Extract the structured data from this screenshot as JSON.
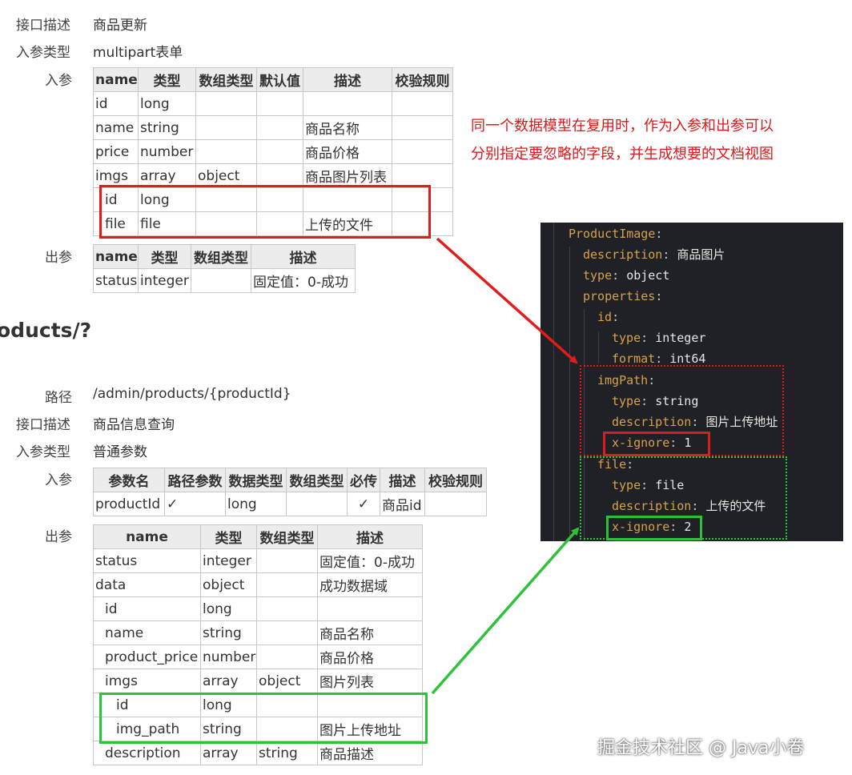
{
  "section1": {
    "desc_label": "接口描述",
    "desc_value": "商品更新",
    "type_label": "入参类型",
    "type_value": "multipart表单",
    "in_label": "入参",
    "in_headers": [
      "name",
      "类型",
      "数组类型",
      "默认值",
      "描述",
      "校验规则"
    ],
    "in_rows": [
      {
        "name": "id",
        "type": "long",
        "arr": "",
        "def": "",
        "desc": "",
        "rule": ""
      },
      {
        "name": "name",
        "type": "string",
        "arr": "",
        "def": "",
        "desc": "商品名称",
        "rule": ""
      },
      {
        "name": "price",
        "type": "number",
        "arr": "",
        "def": "",
        "desc": "商品价格",
        "rule": ""
      },
      {
        "name": "imgs",
        "type": "array",
        "arr": "object",
        "def": "",
        "desc": "商品图片列表",
        "rule": ""
      },
      {
        "name": "id",
        "type": "long",
        "arr": "",
        "def": "",
        "desc": "",
        "rule": ""
      },
      {
        "name": "file",
        "type": "file",
        "arr": "",
        "def": "",
        "desc": "上传的文件",
        "rule": ""
      }
    ],
    "out_label": "出参",
    "out_headers": [
      "name",
      "类型",
      "数组类型",
      "描述"
    ],
    "out_rows": [
      {
        "name": "status",
        "type": "integer",
        "arr": "",
        "desc": "固定值：0-成功"
      }
    ]
  },
  "annotation": {
    "line1": "同一个数据模型在复用时，作为入参和出参可以",
    "line2": "分别指定要忽略的字段，并生成想要的文档视图"
  },
  "heading": "oducts/?",
  "section2": {
    "path_label": "路径",
    "path_value": "/admin/products/{productId}",
    "desc_label": "接口描述",
    "desc_value": "商品信息查询",
    "type_label": "入参类型",
    "type_value": "普通参数",
    "in_label": "入参",
    "in_headers": [
      "参数名",
      "路径参数",
      "数据类型",
      "数组类型",
      "必传",
      "描述",
      "校验规则"
    ],
    "in_rows": [
      {
        "name": "productId",
        "path": "✓",
        "type": "long",
        "arr": "",
        "req": "✓",
        "desc": "商品id",
        "rule": ""
      }
    ],
    "out_label": "出参",
    "out_headers": [
      "name",
      "类型",
      "数组类型",
      "描述"
    ],
    "out_rows": [
      {
        "name": "status",
        "type": "integer",
        "arr": "",
        "desc": "固定值：0-成功"
      },
      {
        "name": "data",
        "type": "object",
        "arr": "",
        "desc": "成功数据域"
      },
      {
        "name": "id",
        "type": "long",
        "arr": "",
        "desc": ""
      },
      {
        "name": "name",
        "type": "string",
        "arr": "",
        "desc": "商品名称"
      },
      {
        "name": "product_price",
        "type": "number",
        "arr": "",
        "desc": "商品价格"
      },
      {
        "name": "imgs",
        "type": "array",
        "arr": "object",
        "desc": "图片列表"
      },
      {
        "name": "id",
        "type": "long",
        "arr": "",
        "desc": ""
      },
      {
        "name": "img_path",
        "type": "string",
        "arr": "",
        "desc": "图片上传地址"
      },
      {
        "name": "description",
        "type": "array",
        "arr": "string",
        "desc": "商品描述"
      }
    ]
  },
  "code": {
    "lines": [
      {
        "key": "ProductImage",
        "sep": ":",
        "val": ""
      },
      {
        "key": "description",
        "sep": ": ",
        "val": "商品图片"
      },
      {
        "key": "type",
        "sep": ": ",
        "val": "object"
      },
      {
        "key": "properties",
        "sep": ":",
        "val": ""
      },
      {
        "key": "id",
        "sep": ":",
        "val": ""
      },
      {
        "key": "type",
        "sep": ": ",
        "val": "integer"
      },
      {
        "key": "format",
        "sep": ": ",
        "val": "int64"
      },
      {
        "key": "imgPath",
        "sep": ":",
        "val": ""
      },
      {
        "key": "type",
        "sep": ": ",
        "val": "string"
      },
      {
        "key": "description",
        "sep": ": ",
        "val": "图片上传地址"
      },
      {
        "key": "x-ignore",
        "sep": ": ",
        "val": "1"
      },
      {
        "key": "file",
        "sep": ":",
        "val": ""
      },
      {
        "key": "type",
        "sep": ": ",
        "val": "file"
      },
      {
        "key": "description",
        "sep": ": ",
        "val": "上传的文件"
      },
      {
        "key": "x-ignore",
        "sep": ": ",
        "val": "2"
      }
    ]
  },
  "watermark": "掘金技术社区 @ Java小卷",
  "colors": {
    "annotation_red": "#e0161a",
    "highlight_green": "#2ec23a",
    "code_key": "#d7a24a",
    "code_bg": "#1f2126"
  }
}
